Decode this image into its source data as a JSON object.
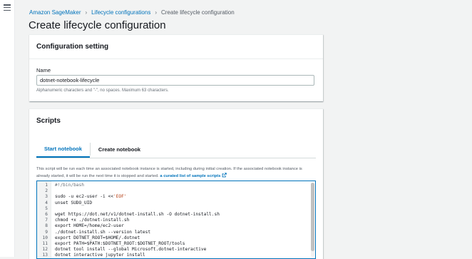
{
  "breadcrumb": {
    "items": [
      "Amazon SageMaker",
      "Lifecycle configurations",
      "Create lifecycle configuration"
    ]
  },
  "page": {
    "title": "Create lifecycle configuration"
  },
  "configuration": {
    "heading": "Configuration setting",
    "name_label": "Name",
    "name_value": "dotnet-notebook-lifecycle",
    "constraint": "Alphanumeric characters and \"-\", no spaces. Maximum 63 characters."
  },
  "scripts": {
    "heading": "Scripts",
    "tabs": [
      "Start notebook",
      "Create notebook"
    ],
    "active_tab": "Start notebook",
    "help_text": "This script will be run each time an associated notebook instance is started, including during initial creation. If the associated notebook instance is already started, it will be run the next time it is stopped and started.",
    "help_link": "a curated list of sample scripts",
    "code_lines": [
      {
        "n": "1",
        "text": "#!/bin/bash"
      },
      {
        "n": "2",
        "text": ""
      },
      {
        "n": "3",
        "text": "sudo -u ec2-user -i <<'EOF'"
      },
      {
        "n": "4",
        "text": "unset SUDO_UID"
      },
      {
        "n": "5",
        "text": ""
      },
      {
        "n": "6",
        "text": "wget https://dot.net/v1/dotnet-install.sh -O dotnet-install.sh"
      },
      {
        "n": "7",
        "text": "chmod +x ./dotnet-install.sh"
      },
      {
        "n": "8",
        "text": "export HOME=/home/ec2-user"
      },
      {
        "n": "9",
        "text": "./dotnet-install.sh --version latest"
      },
      {
        "n": "10",
        "text": "export DOTNET_ROOT=$HOME/.dotnet"
      },
      {
        "n": "11",
        "text": "export PATH=$PATH:$DOTNET_ROOT:$DOTNET_ROOT/tools"
      },
      {
        "n": "12",
        "text": "dotnet tool install --global Microsoft.dotnet-interactive"
      },
      {
        "n": "13",
        "text": "dotnet interactive jupyter install"
      }
    ]
  },
  "colors": {
    "link": "#0073bb",
    "background": "#f2f3f3",
    "string_literal": "#b33a0f"
  }
}
